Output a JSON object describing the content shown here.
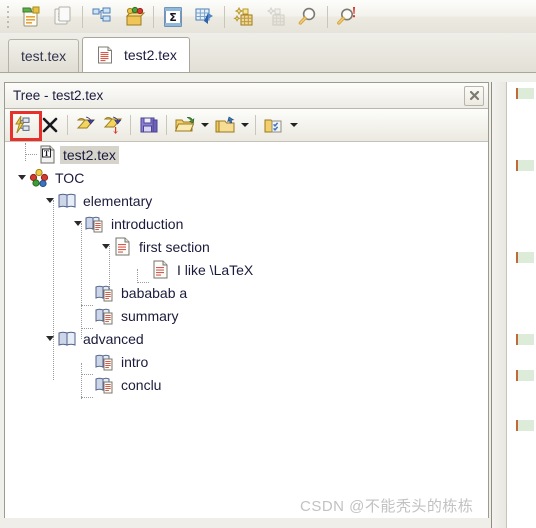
{
  "window": {
    "main_toolbar": {
      "name": "main-toolbar",
      "groups": [
        {
          "buttons": [
            {
              "name": "new-document-button",
              "icon": "new-document-icon",
              "title": "New document"
            },
            {
              "name": "copy-document-button",
              "icon": "copy-document-icon",
              "title": "Copy",
              "disabled": true
            }
          ]
        },
        {
          "buttons": [
            {
              "name": "structure-tree-button",
              "icon": "structure-tree-icon",
              "title": "Structure"
            },
            {
              "name": "package-button",
              "icon": "package-box-icon",
              "title": "Package"
            }
          ]
        },
        {
          "buttons": [
            {
              "name": "sigma-table-button",
              "icon": "sigma-table-icon",
              "title": "Sum table"
            },
            {
              "name": "blue-table-button",
              "icon": "blue-table-icon",
              "title": "Table tool"
            }
          ]
        },
        {
          "buttons": [
            {
              "name": "grid-sparkle-button",
              "icon": "grid-sparkle-icon",
              "title": "Grid"
            },
            {
              "name": "grid-faded-button",
              "icon": "grid-faded-icon",
              "title": "Grid (disabled)",
              "disabled": true
            },
            {
              "name": "search-button",
              "icon": "magnifier-icon",
              "title": "Search"
            }
          ]
        },
        {
          "buttons": [
            {
              "name": "search-alert-button",
              "icon": "magnifier-alert-icon",
              "title": "Search with alert"
            }
          ]
        }
      ]
    },
    "tabs": {
      "name": "document-tabs",
      "items": [
        {
          "label": "test.tex",
          "active": false,
          "icon": null
        },
        {
          "label": "test2.tex",
          "active": true,
          "icon": "tex-document-icon"
        }
      ]
    }
  },
  "tree_panel": {
    "caption": "Tree - test2.tex",
    "close_label": "✖",
    "toolbar": {
      "buttons": [
        {
          "name": "refresh-structure-button",
          "icon": "refresh-structure-icon",
          "title": "Refresh structure",
          "highlighted": true
        },
        {
          "name": "delete-node-button",
          "icon": "close-x-icon",
          "title": "Delete"
        },
        {
          "name": "undo-button",
          "icon": "undo-scroll-icon",
          "title": "Undo"
        },
        {
          "name": "redo-button",
          "icon": "redo-scroll-icon",
          "title": "Redo"
        },
        {
          "name": "save-button",
          "icon": "save-disk-icon",
          "title": "Save"
        },
        {
          "name": "open-folder-button",
          "icon": "open-folder-refresh-icon",
          "title": "Open",
          "dropdown": true
        },
        {
          "name": "new-folder-button",
          "icon": "new-folder-icon",
          "title": "New folder",
          "dropdown": true
        },
        {
          "name": "checklist-folder-button",
          "icon": "checklist-folder-icon",
          "title": "Checklist",
          "dropdown": true
        }
      ]
    },
    "tree": {
      "nodes": [
        {
          "label": "test2.tex",
          "icon": "tex-file-icon",
          "depth": 1,
          "twisty": "none",
          "selected": true
        },
        {
          "label": "TOC",
          "icon": "toc-balls-icon",
          "depth": 0,
          "twisty": "open",
          "selected": false
        },
        {
          "label": "elementary",
          "icon": "book-icon",
          "depth": 1,
          "twisty": "open",
          "selected": false
        },
        {
          "label": "introduction",
          "icon": "section-book-icon",
          "depth": 2,
          "twisty": "open",
          "selected": false
        },
        {
          "label": "first section",
          "icon": "page-lines-icon",
          "depth": 3,
          "twisty": "open",
          "selected": false
        },
        {
          "label": "I like \\LaTeX",
          "icon": "page-lines-icon",
          "depth": 4,
          "twisty": "none",
          "selected": false
        },
        {
          "label": "bababab a",
          "icon": "section-book-icon",
          "depth": 2,
          "twisty": "none",
          "selected": false
        },
        {
          "label": "summary",
          "icon": "section-book-icon",
          "depth": 2,
          "twisty": "none",
          "selected": false
        },
        {
          "label": "advanced",
          "icon": "book-icon",
          "depth": 1,
          "twisty": "open",
          "selected": false
        },
        {
          "label": "intro",
          "icon": "section-book-icon",
          "depth": 2,
          "twisty": "none",
          "selected": false
        },
        {
          "label": "conclu",
          "icon": "section-book-icon",
          "depth": 2,
          "twisty": "none",
          "selected": false
        }
      ]
    }
  },
  "watermark": {
    "text": "CSDN @不能秃头的栋栋"
  },
  "colors": {
    "highlight_red": "#e8302a",
    "selection_gray": "#d6d3cb",
    "panel_border": "#9d9b90",
    "toolbar_bg": "#f3f2ec",
    "tree_bg": "#ffffff",
    "watermark_gray": "#c2c2c2"
  }
}
